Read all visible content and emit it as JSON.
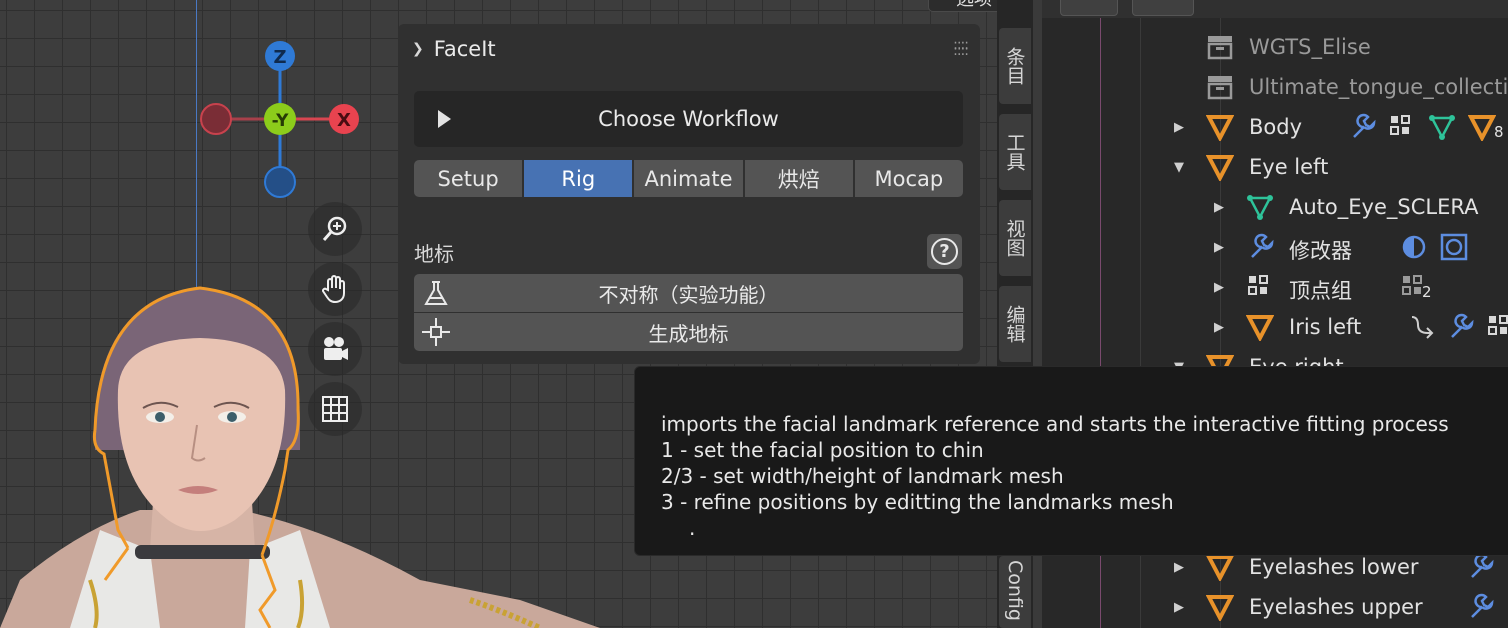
{
  "viewport": {
    "gizmo": {
      "z": "Z",
      "y": "-Y",
      "x": "X"
    },
    "nav_icons": [
      "zoom-icon",
      "hand-pan-icon",
      "camera-icon",
      "grid-icon"
    ],
    "top_partial_label": "选项"
  },
  "faceit_panel": {
    "title": "FaceIt",
    "workflow_button": "Choose Workflow",
    "tabs": [
      {
        "label": "Setup",
        "active": false
      },
      {
        "label": "Rig",
        "active": true
      },
      {
        "label": "Animate",
        "active": false
      },
      {
        "label": "烘焙",
        "active": false
      },
      {
        "label": "Mocap",
        "active": false
      }
    ],
    "section_label": "地标",
    "help_label": "?",
    "asym_button": "不对称（实验功能）",
    "generate_button": "生成地标"
  },
  "side_tabs": [
    "条目",
    "工具",
    "视图",
    "编辑",
    "Config"
  ],
  "outliner": {
    "rows": [
      {
        "label": "WGTS_Elise",
        "icon": "collection-icon",
        "dim": true
      },
      {
        "label": "Ultimate_tongue_collecti",
        "icon": "collection-icon",
        "dim": true
      },
      {
        "label": "Body",
        "icon": "mesh-object-icon",
        "arrow": "▶",
        "badge": "8"
      },
      {
        "label": "Eye left",
        "icon": "mesh-object-icon",
        "arrow": "▼"
      },
      {
        "label": "Auto_Eye_SCLERA",
        "icon": "mesh-data-icon",
        "arrow": "▶"
      },
      {
        "label": "修改器",
        "icon": "wrench-icon",
        "arrow": "▶"
      },
      {
        "label": "顶点组",
        "icon": "vertex-group-icon",
        "arrow": "▶",
        "badge": "2"
      },
      {
        "label": "Iris left",
        "icon": "mesh-object-icon",
        "arrow": "▶"
      },
      {
        "label": "Eye right",
        "icon": "mesh-object-icon",
        "arrow": "▼"
      },
      {
        "label": "Eyelashes lower",
        "icon": "mesh-object-icon",
        "arrow": "▶"
      },
      {
        "label": "Eyelashes upper",
        "icon": "mesh-object-icon",
        "arrow": "▶"
      }
    ]
  },
  "tooltip": {
    "lines": [
      "imports the facial landmark reference and starts the interactive fitting process",
      "1 - set the facial position to chin",
      "2/3 - set width/height of landmark mesh",
      "3 - refine positions by editting the landmarks mesh",
      "."
    ]
  },
  "colors": {
    "accent": "#4772b3",
    "orange": "#e8922a",
    "axis_x": "#e8434f",
    "axis_y": "#8ccc1b",
    "axis_z": "#2f7ad6"
  }
}
